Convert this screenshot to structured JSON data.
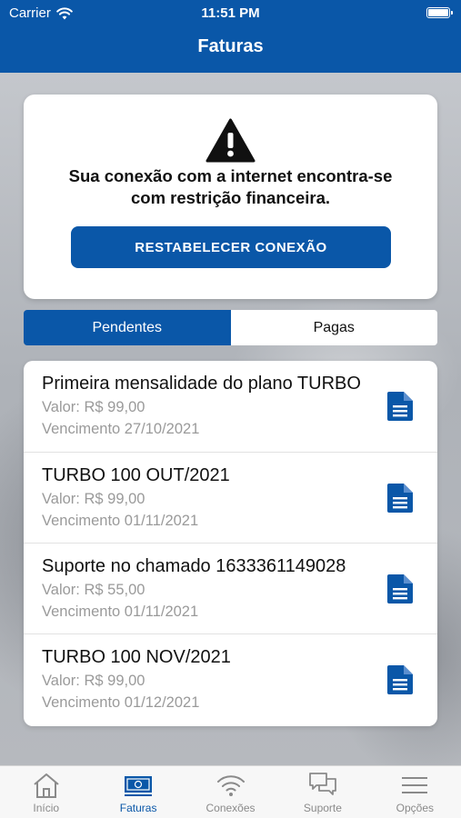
{
  "status_bar": {
    "carrier": "Carrier",
    "time": "11:51 PM"
  },
  "header": {
    "title": "Faturas"
  },
  "alert": {
    "line1": "Sua conexão com a internet encontra-se",
    "line2": "com restrição financeira.",
    "button_label": "RESTABELECER CONEXÃO"
  },
  "tabs": [
    {
      "label": "Pendentes",
      "active": true
    },
    {
      "label": "Pagas",
      "active": false
    }
  ],
  "invoices": [
    {
      "title": "Primeira mensalidade do plano TURBO",
      "value": "Valor: R$ 99,00",
      "due": "Vencimento 27/10/2021"
    },
    {
      "title": "TURBO 100 OUT/2021",
      "value": "Valor: R$ 99,00",
      "due": "Vencimento 01/11/2021"
    },
    {
      "title": "Suporte no chamado 1633361149028",
      "value": "Valor: R$ 55,00",
      "due": "Vencimento 01/11/2021"
    },
    {
      "title": "TURBO 100 NOV/2021",
      "value": "Valor: R$ 99,00",
      "due": "Vencimento 01/12/2021"
    }
  ],
  "bottom_nav": [
    {
      "label": "Início",
      "icon": "home-icon",
      "active": false
    },
    {
      "label": "Faturas",
      "icon": "banknote-icon",
      "active": true
    },
    {
      "label": "Conexões",
      "icon": "wifi-icon",
      "active": false
    },
    {
      "label": "Suporte",
      "icon": "chat-icon",
      "active": false
    },
    {
      "label": "Opções",
      "icon": "menu-icon",
      "active": false
    }
  ],
  "colors": {
    "brand_blue": "#0a57a8",
    "inactive_gray": "#8a8a8a"
  }
}
